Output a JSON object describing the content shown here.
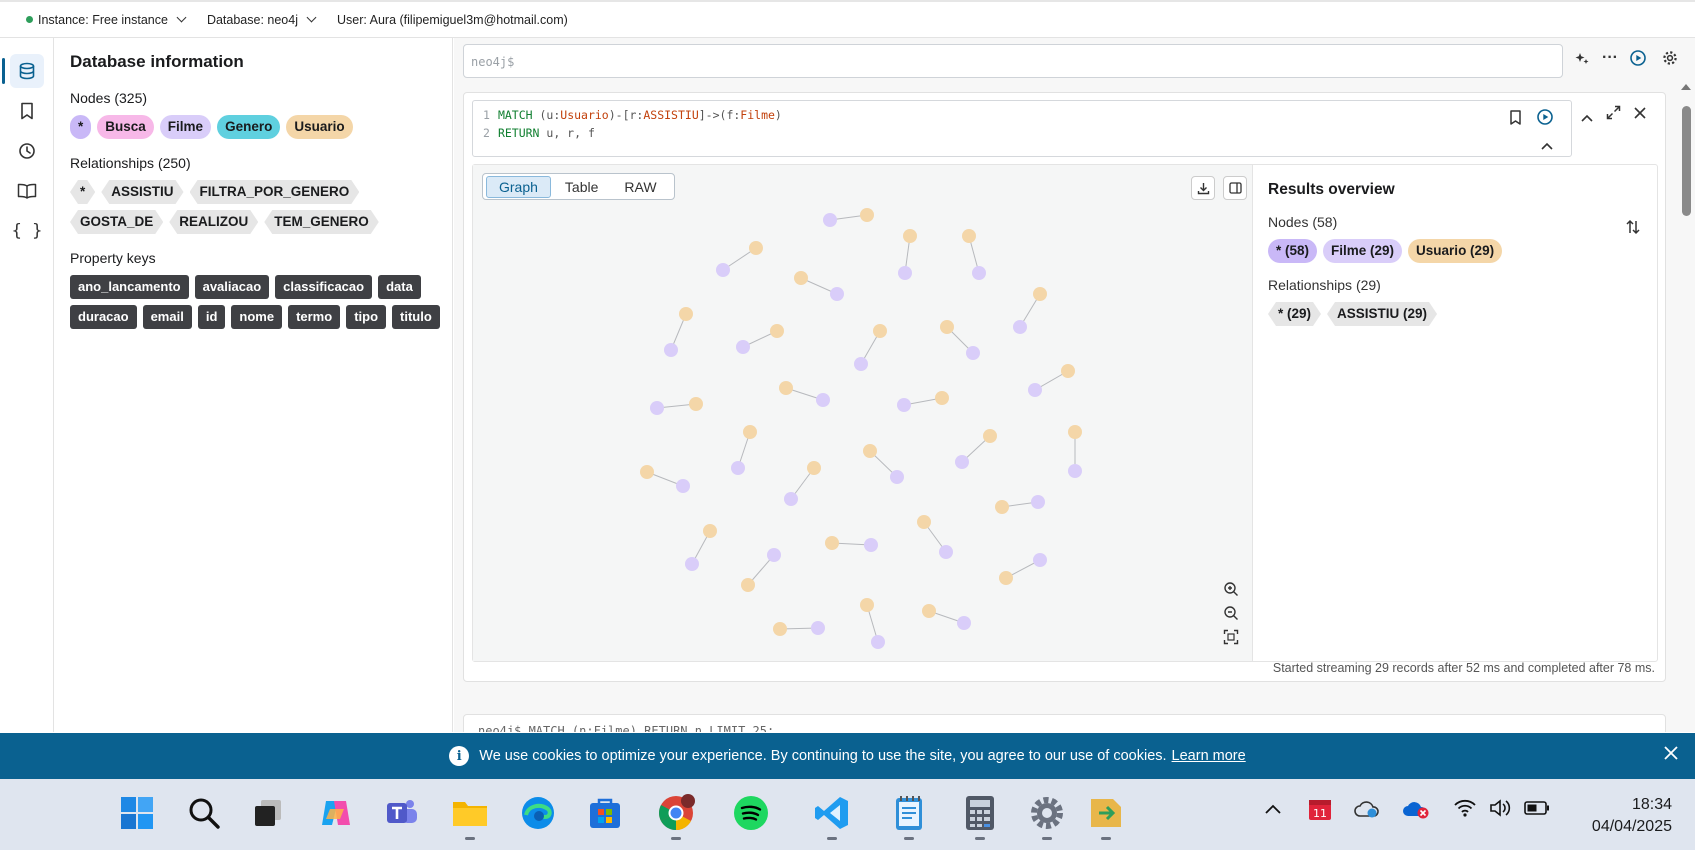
{
  "topbar": {
    "instance": "Instance: Free instance",
    "database": "Database: neo4j",
    "user": "User: Aura (filipemiguel3m@hotmail.com)"
  },
  "sidebar": {
    "icons": [
      "database-icon",
      "bookmark-icon",
      "history-icon",
      "book-icon",
      "braces-icon"
    ],
    "active": "database-icon"
  },
  "db_info": {
    "title": "Database information",
    "nodes_title": "Nodes (325)",
    "node_labels": [
      {
        "label": "*",
        "color": "#c9b8f7"
      },
      {
        "label": "Busca",
        "color": "#f7b8e8"
      },
      {
        "label": "Filme",
        "color": "#d9cdf9"
      },
      {
        "label": "Genero",
        "color": "#5fd0df"
      },
      {
        "label": "Usuario",
        "color": "#f4d6a8"
      }
    ],
    "relationships_title": "Relationships (250)",
    "relationship_types": [
      "*",
      "ASSISTIU",
      "FILTRA_POR_GENERO",
      "GOSTA_DE",
      "REALIZOU",
      "TEM_GENERO"
    ],
    "property_keys_title": "Property keys",
    "property_keys": [
      "ano_lancamento",
      "avaliacao",
      "classificacao",
      "data",
      "duracao",
      "email",
      "id",
      "nome",
      "termo",
      "tipo",
      "titulo"
    ]
  },
  "editor": {
    "placeholder": "neo4j$"
  },
  "query": {
    "line1_num": "1",
    "line2_num": "2",
    "line1": [
      {
        "t": "MATCH ",
        "c": "kw"
      },
      {
        "t": "(u:",
        "c": "pu"
      },
      {
        "t": "Usuario",
        "c": "lb"
      },
      {
        "t": ")-[r:",
        "c": "pu"
      },
      {
        "t": "ASSISTIU",
        "c": "lb"
      },
      {
        "t": "]->(f:",
        "c": "pu"
      },
      {
        "t": "Filme",
        "c": "lb"
      },
      {
        "t": ")",
        "c": "pu"
      }
    ],
    "line2": [
      {
        "t": "RETURN ",
        "c": "kw"
      },
      {
        "t": "u, r, f",
        "c": "pu"
      }
    ]
  },
  "result_tabs": [
    "Graph",
    "Table",
    "RAW"
  ],
  "active_tab": "Graph",
  "overview": {
    "title": "Results overview",
    "nodes_title": "Nodes (58)",
    "node_chips": [
      {
        "label": "* (58)",
        "color": "#c9b8f7"
      },
      {
        "label": "Filme (29)",
        "color": "#d9cdf9"
      },
      {
        "label": "Usuario (29)",
        "color": "#f4d6a8"
      }
    ],
    "relationships_title": "Relationships (29)",
    "relationship_chips": [
      "* (29)",
      "ASSISTIU (29)"
    ]
  },
  "graph": {
    "user_color": "#f4d6a8",
    "movie_color": "#d9cdf9",
    "pairs": [
      [
        [
          867,
          215
        ],
        [
          830,
          220
        ]
      ],
      [
        [
          910,
          236
        ],
        [
          905,
          273
        ]
      ],
      [
        [
          969,
          236
        ],
        [
          979,
          273
        ]
      ],
      [
        [
          756,
          248
        ],
        [
          723,
          270
        ]
      ],
      [
        [
          801,
          278
        ],
        [
          837,
          294
        ]
      ],
      [
        [
          1040,
          294
        ],
        [
          1020,
          327
        ]
      ],
      [
        [
          686,
          314
        ],
        [
          671,
          350
        ]
      ],
      [
        [
          777,
          331
        ],
        [
          743,
          347
        ]
      ],
      [
        [
          880,
          331
        ],
        [
          861,
          364
        ]
      ],
      [
        [
          947,
          327
        ],
        [
          973,
          353
        ]
      ],
      [
        [
          1068,
          371
        ],
        [
          1035,
          390
        ]
      ],
      [
        [
          786,
          388
        ],
        [
          823,
          400
        ]
      ],
      [
        [
          942,
          398
        ],
        [
          904,
          405
        ]
      ],
      [
        [
          696,
          404
        ],
        [
          657,
          408
        ]
      ],
      [
        [
          750,
          432
        ],
        [
          738,
          468
        ]
      ],
      [
        [
          990,
          436
        ],
        [
          962,
          462
        ]
      ],
      [
        [
          1075,
          432
        ],
        [
          1075,
          471
        ]
      ],
      [
        [
          870,
          451
        ],
        [
          897,
          477
        ]
      ],
      [
        [
          647,
          472
        ],
        [
          683,
          486
        ]
      ],
      [
        [
          814,
          468
        ],
        [
          791,
          499
        ]
      ],
      [
        [
          1002,
          507
        ],
        [
          1038,
          502
        ]
      ],
      [
        [
          710,
          531
        ],
        [
          692,
          564
        ]
      ],
      [
        [
          924,
          522
        ],
        [
          946,
          552
        ]
      ],
      [
        [
          832,
          543
        ],
        [
          871,
          545
        ]
      ],
      [
        [
          748,
          585
        ],
        [
          774,
          555
        ]
      ],
      [
        [
          1006,
          578
        ],
        [
          1040,
          560
        ]
      ],
      [
        [
          867,
          605
        ],
        [
          878,
          642
        ]
      ],
      [
        [
          929,
          611
        ],
        [
          964,
          623
        ]
      ],
      [
        [
          780,
          629
        ],
        [
          818,
          628
        ]
      ]
    ]
  },
  "status": "Started streaming 29 records after 52 ms and completed after 78 ms.",
  "next_frame": "neo4j$ MATCH (n:Filme) RETURN n LIMIT 25;",
  "cookie": {
    "text": "We use cookies to optimize your experience. By continuing to use the site, you agree to our use of cookies.",
    "link": "Learn more"
  },
  "taskbar": {
    "apps": [
      "windows-start",
      "search",
      "task-view",
      "copilot",
      "teams",
      "file-explorer",
      "edge",
      "microsoft-store",
      "chrome",
      "spotify",
      "vscode",
      "notepad",
      "calculator",
      "settings",
      "terminal"
    ],
    "notification_badge": "11",
    "time": "18:34",
    "date": "04/04/2025"
  }
}
